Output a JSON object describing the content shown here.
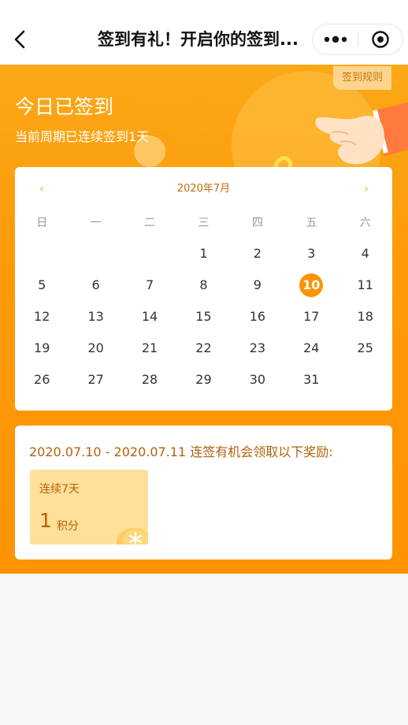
{
  "nav": {
    "title": "签到有礼！开启你的签到..."
  },
  "hero": {
    "rules_label": "签到规则",
    "status_title": "今日已签到",
    "status_sub": "当前周期已连续签到1天"
  },
  "calendar": {
    "prev": "‹",
    "next": "›",
    "month": "2020年7月",
    "weekdays": [
      "日",
      "一",
      "二",
      "三",
      "四",
      "五",
      "六"
    ],
    "weeks": [
      [
        "",
        "",
        "",
        "1",
        "2",
        "3",
        "4"
      ],
      [
        "5",
        "6",
        "7",
        "8",
        "9",
        "10",
        "11"
      ],
      [
        "12",
        "13",
        "14",
        "15",
        "16",
        "17",
        "18"
      ],
      [
        "19",
        "20",
        "21",
        "22",
        "23",
        "24",
        "25"
      ],
      [
        "26",
        "27",
        "28",
        "29",
        "30",
        "31",
        ""
      ]
    ],
    "today": "10"
  },
  "reward": {
    "title": "2020.07.10 - 2020.07.11 连签有机会领取以下奖励:",
    "card": {
      "days": "连续7天",
      "amount": "1",
      "unit": "积分"
    }
  },
  "colors": {
    "accent": "#fe9304",
    "accent_light": "#ffdf99",
    "text_brown": "#b4600a"
  }
}
